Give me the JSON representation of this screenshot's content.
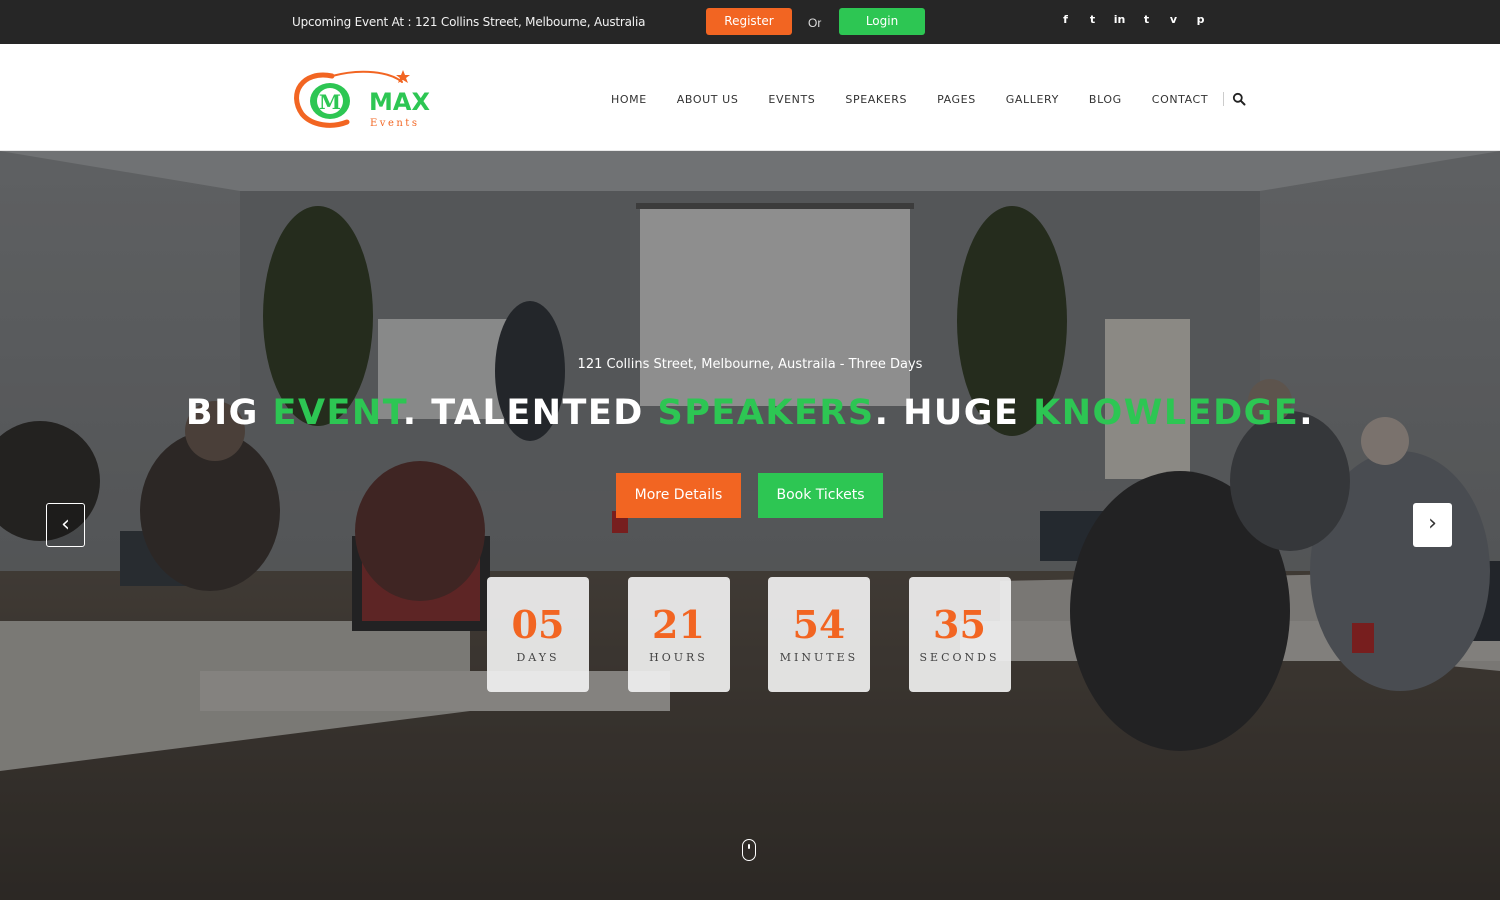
{
  "topbar": {
    "event_info": "Upcoming Event At : 121 Collins Street, Melbourne, Australia",
    "register_label": "Register",
    "or_label": "Or",
    "login_label": "Login",
    "social": [
      {
        "name": "facebook-icon",
        "glyph": "f"
      },
      {
        "name": "twitter-icon",
        "glyph": "t"
      },
      {
        "name": "linkedin-icon",
        "glyph": "in"
      },
      {
        "name": "tumblr-icon",
        "glyph": "t"
      },
      {
        "name": "vimeo-icon",
        "glyph": "v"
      },
      {
        "name": "pinterest-icon",
        "glyph": "p"
      }
    ]
  },
  "logo": {
    "main": "MAX",
    "sub": "Events",
    "mark": "M"
  },
  "nav": {
    "items": [
      "HOME",
      "ABOUT US",
      "EVENTS",
      "SPEAKERS",
      "PAGES",
      "GALLERY",
      "BLOG",
      "CONTACT"
    ],
    "search_icon": "search-icon"
  },
  "hero": {
    "subline": "121 Collins Street, Melbourne, Austraila - Three Days",
    "headline_parts": [
      {
        "text": "BIG ",
        "accent": false
      },
      {
        "text": "EVENT",
        "accent": true
      },
      {
        "text": ". TALENTED ",
        "accent": false
      },
      {
        "text": "SPEAKERS",
        "accent": true
      },
      {
        "text": ". HUGE ",
        "accent": false
      },
      {
        "text": "KNOWLEDGE",
        "accent": true
      },
      {
        "text": ".",
        "accent": false
      }
    ],
    "more_label": "More Details",
    "book_label": "Book Tickets",
    "prev_glyph": "‹",
    "next_glyph": "›"
  },
  "countdown": [
    {
      "value": "05",
      "label": "DAYS"
    },
    {
      "value": "21",
      "label": "HOURS"
    },
    {
      "value": "54",
      "label": "MINUTES"
    },
    {
      "value": "35",
      "label": "SECONDS"
    }
  ],
  "colors": {
    "accent_orange": "#f26522",
    "accent_green": "#2dc653",
    "topbar_bg": "#262626"
  }
}
